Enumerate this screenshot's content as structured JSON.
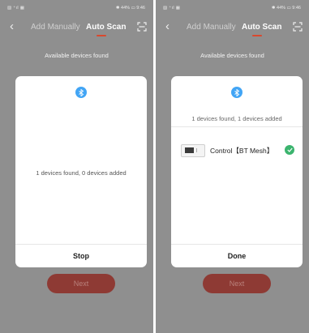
{
  "status_bar": {
    "left": "▨ ⁺ıl ▦",
    "right": "✱ 44% ▭ 9:46"
  },
  "nav": {
    "back_glyph": "‹",
    "tab_manual": "Add Manually",
    "tab_auto": "Auto Scan",
    "scan_icon": "scan-frame-icon"
  },
  "header": "Available devices found",
  "colors": {
    "accent": "#d9482e",
    "next_button": "#8e3a34",
    "bluetooth": "#42a5f5",
    "success": "#3bb46e",
    "overlay": "#8f8f8f"
  },
  "left_dialog": {
    "message": "1 devices found, 0 devices added",
    "button": "Stop"
  },
  "right_dialog": {
    "message": "1 devices found, 1 devices added",
    "device_name": "Control【BT Mesh】",
    "device_status_icon": "check-circle-icon",
    "button": "Done"
  },
  "next_label": "Next"
}
